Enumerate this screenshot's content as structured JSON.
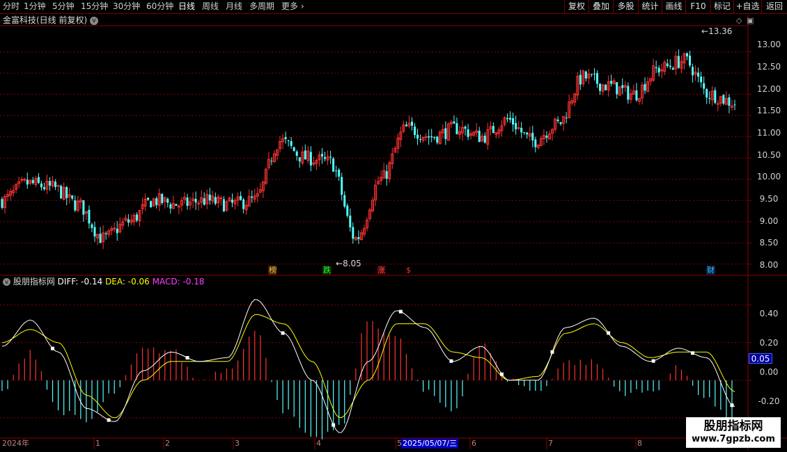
{
  "toolbar": {
    "periods": [
      "分时",
      "1分钟",
      "5分钟",
      "15分钟",
      "30分钟",
      "60分钟",
      "日线",
      "周线",
      "月线",
      "多周期",
      "更多"
    ],
    "active_period": "日线",
    "buttons": [
      "复权",
      "叠加",
      "多股",
      "统计",
      "画线",
      "F10",
      "标记",
      "+自选",
      "返回"
    ]
  },
  "main_chart": {
    "title": "金富科技(日线 前复权)",
    "high_label": "13.36",
    "low_label": "8.05",
    "y_ticks": [
      "13.00",
      "12.50",
      "12.00",
      "11.50",
      "11.00",
      "10.50",
      "10.00",
      "9.50",
      "9.00",
      "8.50",
      "8.00"
    ],
    "event_tags": [
      {
        "text": "榜",
        "color": "#e8c060",
        "bg": "#402000"
      },
      {
        "text": "跌",
        "color": "#30ff30",
        "bg": "#003000"
      },
      {
        "text": "涨",
        "color": "#ff5050",
        "bg": "#300000"
      },
      {
        "text": "$",
        "color": "#ff3030",
        "bg": "#000000"
      },
      {
        "text": "财",
        "color": "#40c0ff",
        "bg": "#002040"
      }
    ]
  },
  "indicator": {
    "name": "股朋指标网",
    "diff_label": "DIFF: -0.14",
    "dea_label": "DEA: -0.06",
    "macd_label": "MACD: -0.18",
    "y_ticks": [
      "0.40",
      "0.20",
      "0.00",
      "-0.20"
    ],
    "current_value": "0.05"
  },
  "x_axis": {
    "labels": [
      "2024年",
      "1",
      "2",
      "3",
      "4",
      "5",
      "6",
      "7",
      "8"
    ],
    "cursor_date": "2025/05/07/三"
  },
  "watermark": {
    "cn": "股朋指标网",
    "url": "www.7gpzb.com"
  },
  "colors": {
    "up": "#ff3232",
    "down": "#54ffff",
    "diff": "#ffffff",
    "dea": "#ffff00",
    "macd_label": "#ff40ff",
    "grid": "#8b0000"
  },
  "chart_data": {
    "type": "candlestick",
    "ylim": [
      7.8,
      13.6
    ],
    "x": [
      "2024-12",
      "2025-01",
      "2025-02",
      "2025-03",
      "2025-04",
      "2025-05",
      "2025-06",
      "2025-07",
      "2025-08"
    ],
    "close": [
      9.5,
      9.9,
      9.8,
      9.4,
      8.6,
      9.0,
      9.5,
      9.4,
      9.5,
      9.4,
      9.5,
      10.9,
      10.5,
      10.4,
      8.6,
      10.0,
      11.2,
      11.0,
      11.2,
      11.0,
      11.4,
      10.9,
      11.3,
      12.4,
      12.2,
      12.0,
      12.6,
      12.8,
      12.0,
      11.8
    ],
    "macd_ylim": [
      -0.3,
      0.55
    ],
    "diff": [
      0.18,
      0.32,
      0.15,
      -0.15,
      -0.22,
      0.05,
      0.15,
      0.1,
      0.12,
      0.43,
      0.25,
      0.0,
      -0.28,
      0.1,
      0.37,
      0.28,
      0.1,
      0.18,
      0.0,
      0.0,
      0.28,
      0.33,
      0.18,
      0.1,
      0.17,
      0.12,
      -0.14
    ],
    "dea": [
      0.2,
      0.27,
      0.2,
      -0.08,
      -0.2,
      0.0,
      0.1,
      0.1,
      0.1,
      0.35,
      0.3,
      0.1,
      -0.2,
      0.0,
      0.3,
      0.3,
      0.15,
      0.12,
      0.0,
      0.02,
      0.25,
      0.3,
      0.2,
      0.12,
      0.15,
      0.15,
      -0.06
    ]
  }
}
